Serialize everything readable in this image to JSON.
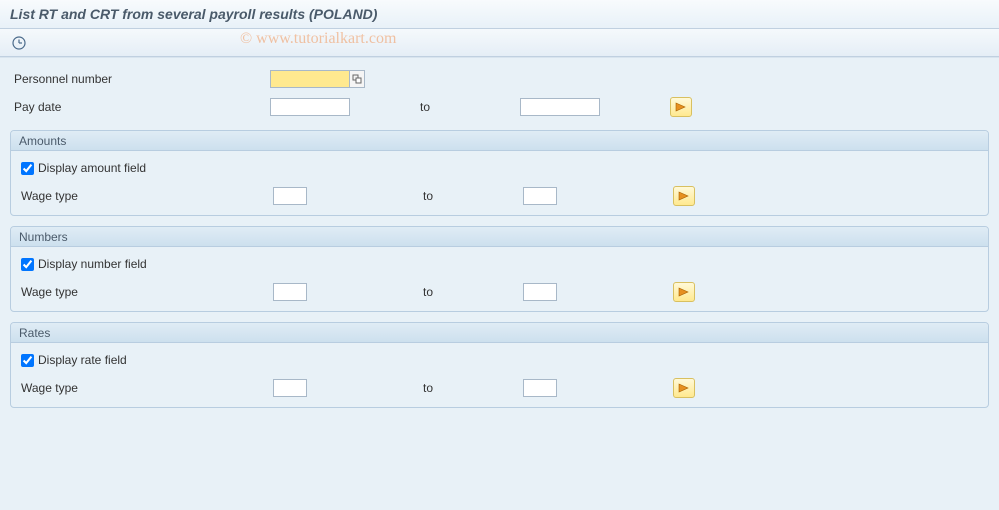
{
  "title": "List RT and CRT from several payroll results (POLAND)",
  "watermark": "© www.tutorialkart.com",
  "labels": {
    "personnel_number": "Personnel number",
    "pay_date": "Pay date",
    "to": "to",
    "wage_type": "Wage type"
  },
  "fields": {
    "personnel_number": "",
    "pay_date_from": "",
    "pay_date_to": ""
  },
  "groups": {
    "amounts": {
      "title": "Amounts",
      "display_checkbox_label": "Display amount field",
      "display_checked": true,
      "wage_type_from": "",
      "wage_type_to": ""
    },
    "numbers": {
      "title": "Numbers",
      "display_checkbox_label": "Display number field",
      "display_checked": true,
      "wage_type_from": "",
      "wage_type_to": ""
    },
    "rates": {
      "title": "Rates",
      "display_checkbox_label": "Display rate field",
      "display_checked": true,
      "wage_type_from": "",
      "wage_type_to": ""
    }
  },
  "icons": {
    "clock": "clock-icon",
    "f4": "search-help-icon",
    "multi_select": "multiple-selection-icon"
  }
}
